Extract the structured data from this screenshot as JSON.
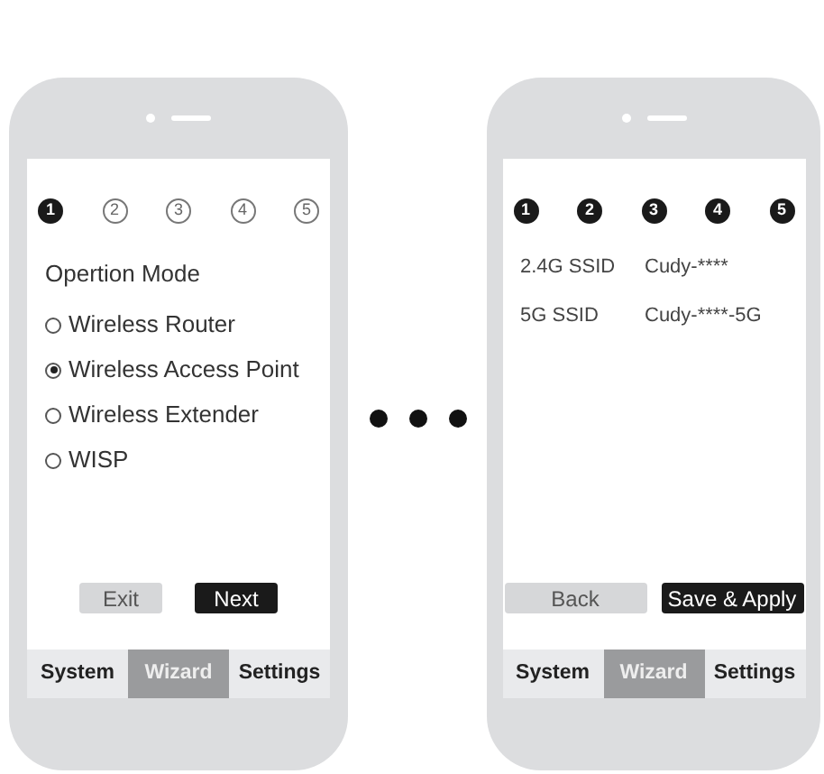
{
  "phones": [
    {
      "steps": [
        {
          "label": "1",
          "done": true
        },
        {
          "label": "2",
          "done": false
        },
        {
          "label": "3",
          "done": false
        },
        {
          "label": "4",
          "done": false
        },
        {
          "label": "5",
          "done": false
        }
      ],
      "title": "Opertion Mode",
      "options": [
        {
          "label": "Wireless Router",
          "selected": false
        },
        {
          "label": "Wireless Access Point",
          "selected": true
        },
        {
          "label": "Wireless Extender",
          "selected": false
        },
        {
          "label": "WISP",
          "selected": false
        }
      ],
      "buttons": [
        {
          "label": "Exit",
          "kind": "secondary"
        },
        {
          "label": "Next",
          "kind": "primary"
        }
      ],
      "tabs": [
        {
          "label": "System",
          "selected": false
        },
        {
          "label": "Wizard",
          "selected": true
        },
        {
          "label": "Settings",
          "selected": false
        }
      ]
    },
    {
      "steps": [
        {
          "label": "1",
          "done": true
        },
        {
          "label": "2",
          "done": true
        },
        {
          "label": "3",
          "done": true
        },
        {
          "label": "4",
          "done": true
        },
        {
          "label": "5",
          "done": true
        }
      ],
      "fields": [
        {
          "label": "2.4G SSID",
          "value": "Cudy-****"
        },
        {
          "label": "5G SSID",
          "value": "Cudy-****-5G"
        }
      ],
      "buttons": [
        {
          "label": "Back",
          "kind": "secondary"
        },
        {
          "label": "Save & Apply",
          "kind": "primary"
        }
      ],
      "tabs": [
        {
          "label": "System",
          "selected": false
        },
        {
          "label": "Wizard",
          "selected": true
        },
        {
          "label": "Settings",
          "selected": false
        }
      ]
    }
  ]
}
